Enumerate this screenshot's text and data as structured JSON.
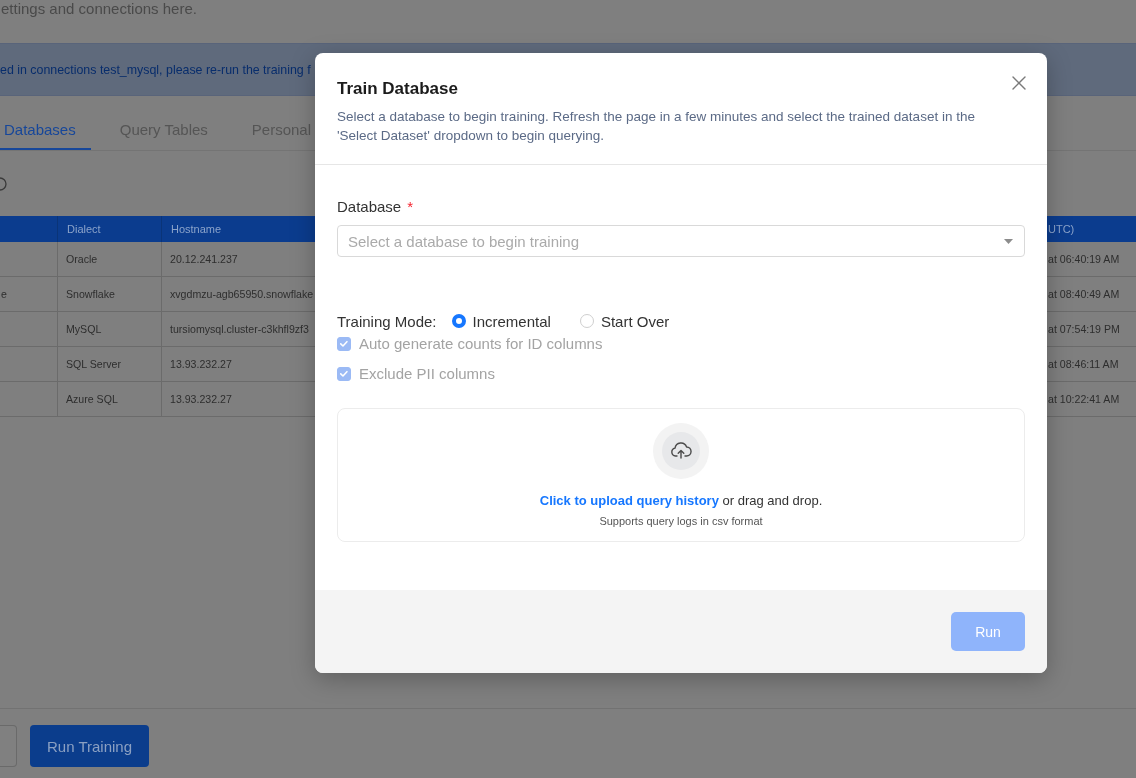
{
  "page": {
    "subtitle": "ettings and connections here."
  },
  "banner": {
    "text": "ed in connections test_mysql, please re-run the training f"
  },
  "tabs": [
    {
      "label": "Databases",
      "selected": true
    },
    {
      "label": "Query Tables",
      "selected": false
    },
    {
      "label": "Personal",
      "selected": false
    }
  ],
  "table": {
    "header": {
      "dialect": "Dialect",
      "hostname": "Hostname",
      "column_4": "UTC)"
    },
    "rows": [
      {
        "dialect": "Oracle",
        "hostname": "20.12.241.237",
        "column_4": "at 06:40:19 AM"
      },
      {
        "column_1": "e",
        "dialect": "Snowflake",
        "hostname": "xvgdmzu-agb65950.snowflake",
        "column_4": "at 08:40:49 AM"
      },
      {
        "dialect": "MySQL",
        "hostname": "tursiomysql.cluster-c3khfl9zf3",
        "column_4": "at 07:54:19 PM"
      },
      {
        "dialect": "SQL Server",
        "hostname": "13.93.232.27",
        "column_4": "at 08:46:11 AM"
      },
      {
        "dialect": "Azure SQL",
        "hostname": "13.93.232.27",
        "column_4": "at 10:22:41 AM"
      }
    ]
  },
  "footer_buttons": [
    {
      "kind": "outline"
    },
    {
      "kind": "primary",
      "label": "Run Training"
    }
  ],
  "modal": {
    "title": "Train Database",
    "description": "Select a database to begin training. Refresh the page in a few minutes and select the trained dataset in the 'Select Dataset' dropdown to begin querying.",
    "database_field": {
      "label": "Database",
      "required_mark": "*",
      "placeholder": "Select a database to begin training"
    },
    "training_mode": {
      "label": "Training Mode:",
      "options": [
        {
          "label": "Incremental",
          "selected": true
        },
        {
          "label": "Start Over",
          "selected": false
        }
      ]
    },
    "checkboxes": [
      {
        "label": "Auto generate counts for ID columns",
        "checked": true,
        "disabled": true
      },
      {
        "label": "Exclude PII columns",
        "checked": true,
        "disabled": true
      }
    ],
    "upload": {
      "link": "Click to upload query history",
      "text": "or drag and drop.",
      "hint": "Supports query logs in csv format"
    },
    "buttons": [
      {
        "label": "Run",
        "disabled": true
      }
    ]
  }
}
